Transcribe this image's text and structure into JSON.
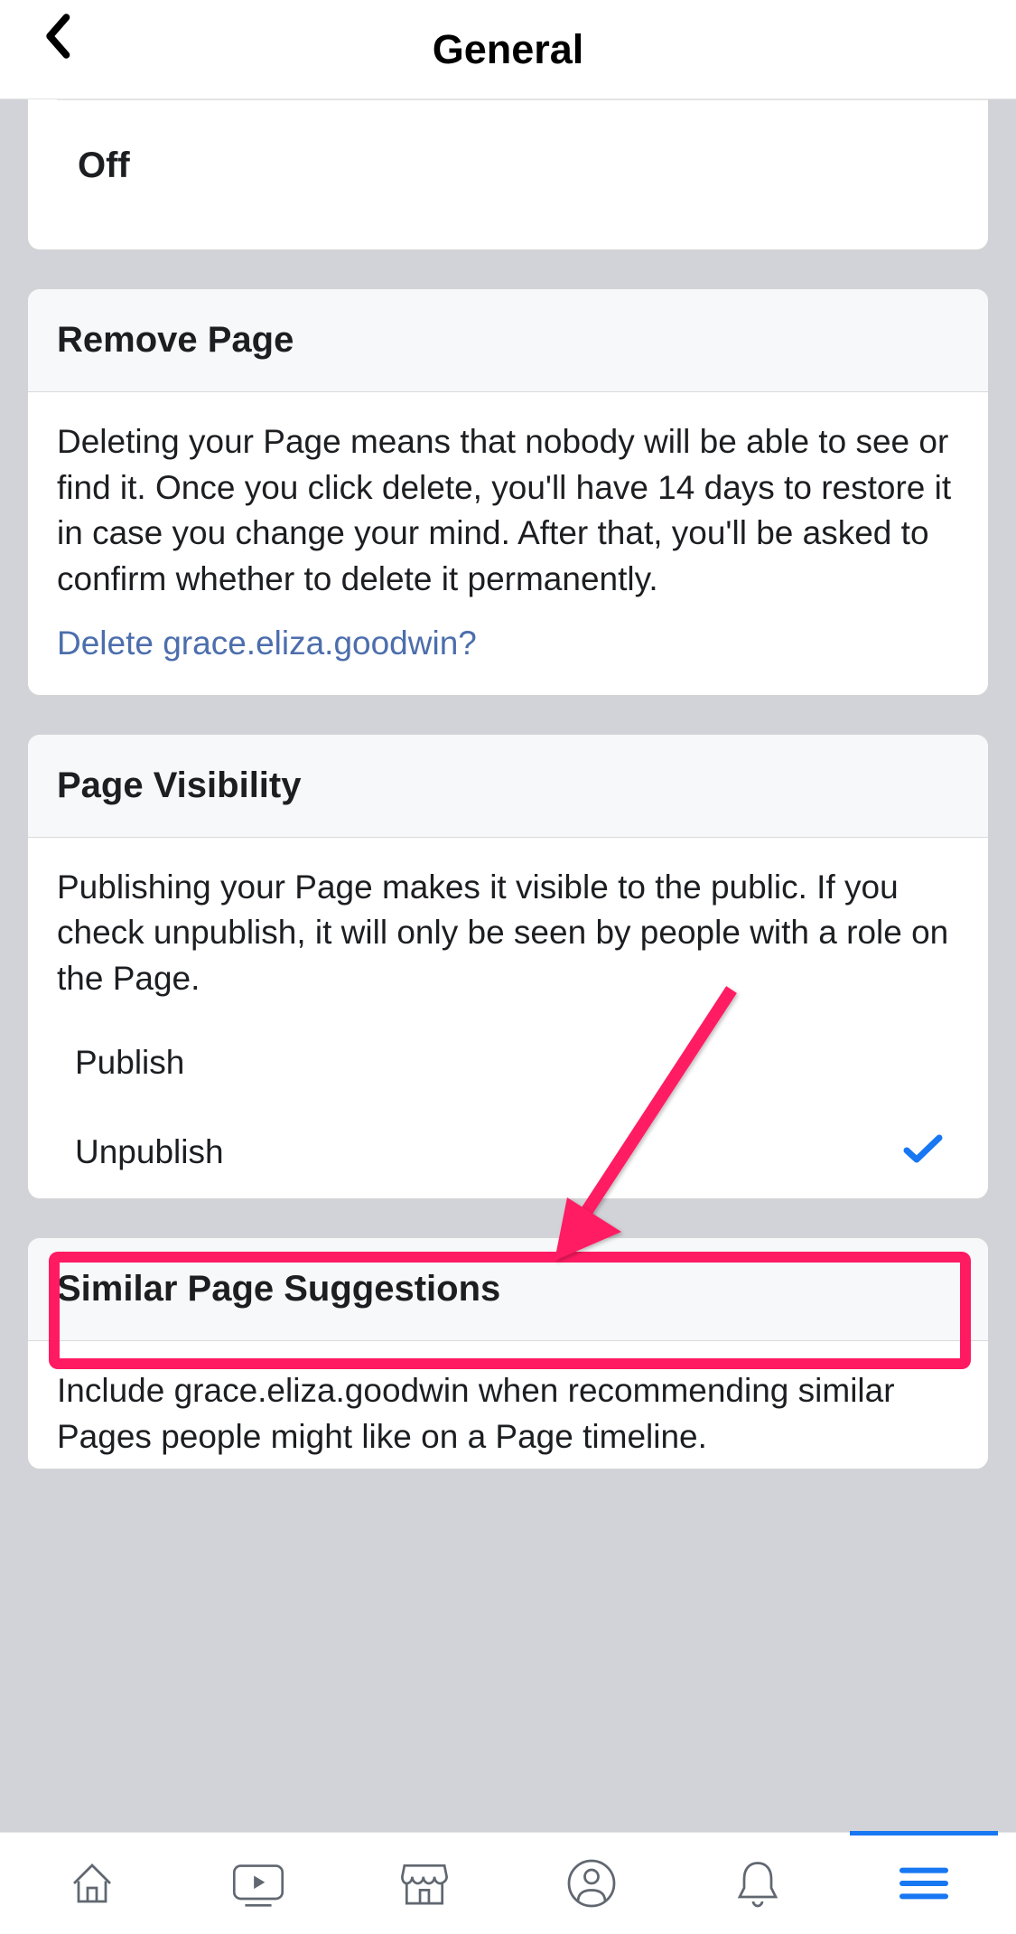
{
  "header": {
    "title": "General"
  },
  "sections": {
    "off": {
      "value": "Off"
    },
    "removePage": {
      "title": "Remove Page",
      "description": "Deleting your Page means that nobody will be able to see or find it. Once you click delete, you'll have 14 days to restore it in case you change your mind. After that, you'll be asked to confirm whether to delete it permanently.",
      "deleteLink": "Delete grace.eliza.goodwin?"
    },
    "pageVisibility": {
      "title": "Page Visibility",
      "description": "Publishing your Page makes it visible to the public. If you check unpublish, it will only be seen by people with a role on the Page.",
      "option_publish": "Publish",
      "option_unpublish": "Unpublish"
    },
    "similarPages": {
      "title": "Similar Page Suggestions",
      "description": "Include grace.eliza.goodwin when recommending similar Pages people might like on a Page timeline."
    }
  }
}
